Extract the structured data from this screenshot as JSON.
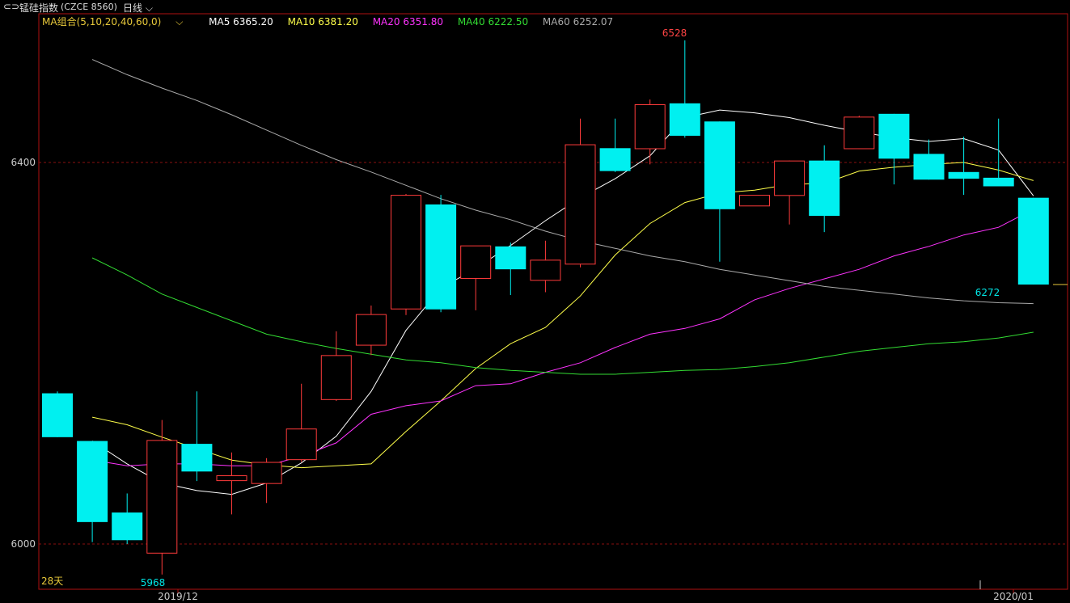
{
  "header": {
    "symbol_name": "锰硅指数",
    "symbol_code": "(CZCE 8560)",
    "period": "日线",
    "chevron": "chevron-down-icon",
    "link_icon": "link-icon"
  },
  "ma_legend": {
    "combo": "MA组合(5,10,20,40,60,0)",
    "items": [
      {
        "label": "MA5 6365.20",
        "color": "#ffffff"
      },
      {
        "label": "MA10 6381.20",
        "color": "#ffff4a"
      },
      {
        "label": "MA20 6351.80",
        "color": "#ff33ff"
      },
      {
        "label": "MA40 6222.50",
        "color": "#33dd33"
      },
      {
        "label": "MA60 6252.07",
        "color": "#aaaaaa"
      }
    ]
  },
  "annotations": {
    "high_label": "6528",
    "low_label": "5968",
    "last_label": "6272",
    "days_label": "28天"
  },
  "chart_data": {
    "type": "candlestick",
    "ylim": [
      5960,
      6550
    ],
    "y_ticks": [
      "6400",
      "6000"
    ],
    "x_ticks": [
      "2019/12",
      "2020/01"
    ],
    "colors": {
      "up": "#ff3b3b",
      "down": "#00f0f0",
      "frame": "#b01010",
      "grid": "#8a1010",
      "axis_label": "#cccccc"
    },
    "candles": [
      {
        "o": 6158,
        "h": 6160,
        "l": 6112,
        "c": 6112
      },
      {
        "o": 6108,
        "h": 6108,
        "l": 6002,
        "c": 6023
      },
      {
        "o": 6033,
        "h": 6053,
        "l": 6000,
        "c": 6004
      },
      {
        "o": 5990,
        "h": 6130,
        "l": 5968,
        "c": 6109
      },
      {
        "o": 6105,
        "h": 6160,
        "l": 6066,
        "c": 6076
      },
      {
        "o": 6066,
        "h": 6096,
        "l": 6031,
        "c": 6072
      },
      {
        "o": 6063,
        "h": 6090,
        "l": 6043,
        "c": 6086
      },
      {
        "o": 6088,
        "h": 6168,
        "l": 6086,
        "c": 6121
      },
      {
        "o": 6151,
        "h": 6223,
        "l": 6150,
        "c": 6198
      },
      {
        "o": 6208,
        "h": 6250,
        "l": 6198,
        "c": 6241
      },
      {
        "o": 6246,
        "h": 6367,
        "l": 6240,
        "c": 6366
      },
      {
        "o": 6356,
        "h": 6366,
        "l": 6243,
        "c": 6246
      },
      {
        "o": 6278,
        "h": 6289,
        "l": 6245,
        "c": 6313
      },
      {
        "o": 6312,
        "h": 6316,
        "l": 6261,
        "c": 6288
      },
      {
        "o": 6276,
        "h": 6318,
        "l": 6264,
        "c": 6298
      },
      {
        "o": 6293,
        "h": 6446,
        "l": 6290,
        "c": 6419
      },
      {
        "o": 6415,
        "h": 6446,
        "l": 6390,
        "c": 6391
      },
      {
        "o": 6414,
        "h": 6466,
        "l": 6398,
        "c": 6461
      },
      {
        "o": 6462,
        "h": 6528,
        "l": 6426,
        "c": 6428
      },
      {
        "o": 6443,
        "h": 6443,
        "l": 6296,
        "c": 6351
      },
      {
        "o": 6354,
        "h": 6354,
        "l": 6354,
        "c": 6366
      },
      {
        "o": 6365,
        "h": 6402,
        "l": 6335,
        "c": 6402
      },
      {
        "o": 6402,
        "h": 6418,
        "l": 6327,
        "c": 6344
      },
      {
        "o": 6414,
        "h": 6449,
        "l": 6414,
        "c": 6448
      },
      {
        "o": 6451,
        "h": 6451,
        "l": 6377,
        "c": 6404
      },
      {
        "o": 6409,
        "h": 6424,
        "l": 6382,
        "c": 6382
      },
      {
        "o": 6390,
        "h": 6427,
        "l": 6366,
        "c": 6383
      },
      {
        "o": 6384,
        "h": 6446,
        "l": 6377,
        "c": 6375
      },
      {
        "o": 6363,
        "h": 6363,
        "l": 6272,
        "c": 6272
      }
    ],
    "series": [
      {
        "name": "MA5",
        "color": "#ffffff",
        "values": [
          null,
          6108,
          6084,
          6064,
          6056,
          6052,
          6064,
          6085,
          6113,
          6160,
          6224,
          6268,
          6289,
          6313,
          6339,
          6363,
          6383,
          6407,
          6447,
          6455,
          6452,
          6447,
          6439,
          6432,
          6426,
          6422,
          6425,
          6413,
          6365
        ]
      },
      {
        "name": "MA10",
        "color": "#ffff4a",
        "values": [
          null,
          6133,
          6125,
          6112,
          6100,
          6088,
          6083,
          6080,
          6082,
          6084,
          6118,
          6150,
          6184,
          6210,
          6227,
          6260,
          6303,
          6336,
          6358,
          6368,
          6371,
          6377,
          6378,
          6391,
          6395,
          6398,
          6400,
          6392,
          6381
        ]
      },
      {
        "name": "MA20",
        "color": "#ff33ff",
        "values": [
          null,
          6088,
          6082,
          6084,
          6084,
          6082,
          6082,
          6092,
          6106,
          6136,
          6145,
          6150,
          6166,
          6168,
          6180,
          6190,
          6206,
          6220,
          6226,
          6236,
          6256,
          6268,
          6278,
          6288,
          6302,
          6312,
          6324,
          6332,
          6351
        ]
      },
      {
        "name": "MA40",
        "color": "#33dd33",
        "values": [
          null,
          6300,
          6282,
          6262,
          6248,
          6234,
          6220,
          6212,
          6205,
          6199,
          6193,
          6190,
          6185,
          6182,
          6180,
          6178,
          6178,
          6180,
          6182,
          6183,
          6186,
          6190,
          6196,
          6202,
          6206,
          6210,
          6212,
          6216,
          6222
        ]
      },
      {
        "name": "MA60",
        "color": "#aaaaaa",
        "values": [
          null,
          6508,
          6492,
          6478,
          6465,
          6450,
          6434,
          6418,
          6403,
          6390,
          6376,
          6362,
          6350,
          6340,
          6328,
          6318,
          6310,
          6302,
          6296,
          6288,
          6282,
          6276,
          6270,
          6266,
          6262,
          6258,
          6255,
          6253,
          6252
        ]
      }
    ]
  }
}
